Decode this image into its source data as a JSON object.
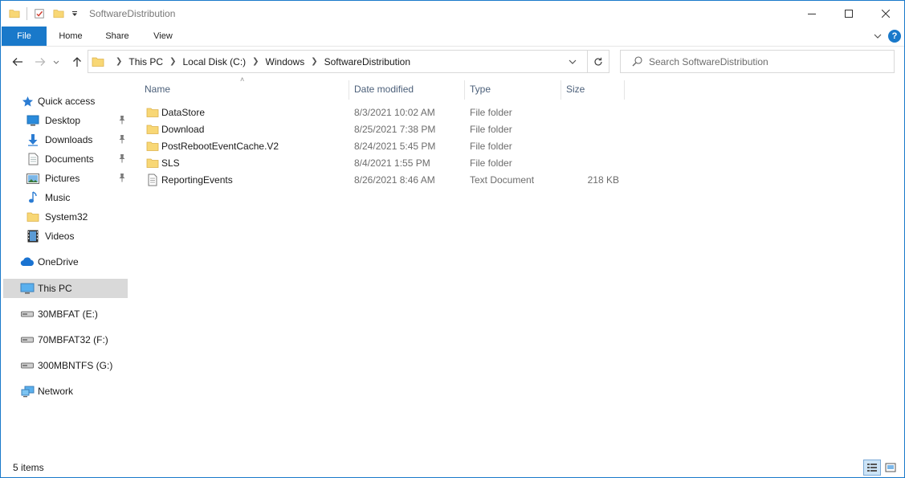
{
  "window": {
    "title": "SoftwareDistribution",
    "accent": "#1979ca"
  },
  "ribbon": {
    "tabs": [
      {
        "label": "File"
      },
      {
        "label": "Home"
      },
      {
        "label": "Share"
      },
      {
        "label": "View"
      }
    ]
  },
  "address": {
    "crumbs": [
      "This PC",
      "Local Disk (C:)",
      "Windows",
      "SoftwareDistribution"
    ]
  },
  "search": {
    "placeholder": "Search SoftwareDistribution"
  },
  "navpane": {
    "items": [
      {
        "label": "Quick access",
        "icon": "star-icon"
      },
      {
        "label": "Desktop",
        "icon": "desktop-icon",
        "pinned": true
      },
      {
        "label": "Downloads",
        "icon": "download-arrow-icon",
        "pinned": true
      },
      {
        "label": "Documents",
        "icon": "document-icon",
        "pinned": true
      },
      {
        "label": "Pictures",
        "icon": "pictures-icon",
        "pinned": true
      },
      {
        "label": "Music",
        "icon": "music-note-icon"
      },
      {
        "label": "System32",
        "icon": "folder-icon"
      },
      {
        "label": "Videos",
        "icon": "film-icon"
      },
      {
        "label": "OneDrive",
        "icon": "cloud-icon"
      },
      {
        "label": "This PC",
        "icon": "computer-icon",
        "selected": true
      },
      {
        "label": "30MBFAT (E:)",
        "icon": "drive-icon"
      },
      {
        "label": "70MBFAT32 (F:)",
        "icon": "drive-icon"
      },
      {
        "label": "300MBNTFS (G:)",
        "icon": "drive-icon"
      },
      {
        "label": "Network",
        "icon": "network-icon"
      }
    ]
  },
  "columns": {
    "name": "Name",
    "date": "Date modified",
    "type": "Type",
    "size": "Size"
  },
  "files": [
    {
      "name": "DataStore",
      "date": "8/3/2021 10:02 AM",
      "type": "File folder",
      "size": "",
      "icon": "folder-icon"
    },
    {
      "name": "Download",
      "date": "8/25/2021 7:38 PM",
      "type": "File folder",
      "size": "",
      "icon": "folder-icon"
    },
    {
      "name": "PostRebootEventCache.V2",
      "date": "8/24/2021 5:45 PM",
      "type": "File folder",
      "size": "",
      "icon": "folder-icon"
    },
    {
      "name": "SLS",
      "date": "8/4/2021 1:55 PM",
      "type": "File folder",
      "size": "",
      "icon": "folder-icon"
    },
    {
      "name": "ReportingEvents",
      "date": "8/26/2021 8:46 AM",
      "type": "Text Document",
      "size": "218 KB",
      "icon": "text-file-icon"
    }
  ],
  "status": {
    "count": "5 items"
  }
}
